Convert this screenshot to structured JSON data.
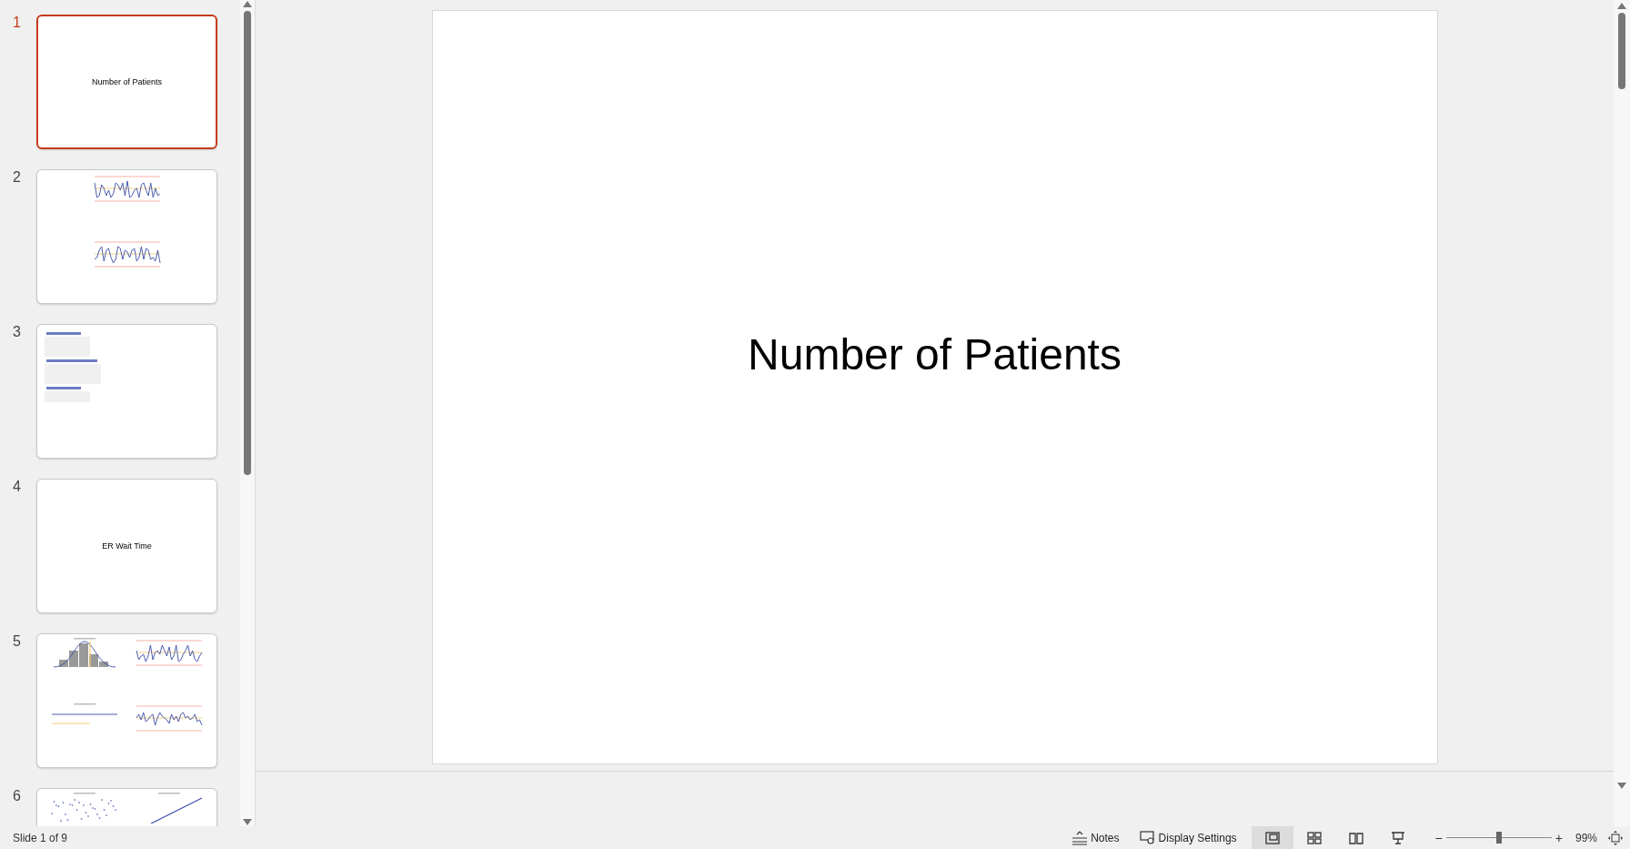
{
  "slides_panel": {
    "slides": [
      {
        "number": "1",
        "selected": true,
        "kind": "title",
        "title": "Number of Patients"
      },
      {
        "number": "2",
        "selected": false,
        "kind": "stack",
        "charts": [
          {
            "kind": "line"
          },
          {
            "kind": "line"
          }
        ]
      },
      {
        "number": "3",
        "selected": false,
        "kind": "stats"
      },
      {
        "number": "4",
        "selected": false,
        "kind": "title",
        "title": "ER Wait Time"
      },
      {
        "number": "5",
        "selected": false,
        "kind": "grid",
        "charts": [
          {
            "kind": "histogram"
          },
          {
            "kind": "line"
          },
          {
            "kind": "range"
          },
          {
            "kind": "line"
          }
        ]
      },
      {
        "number": "6",
        "selected": false,
        "kind": "grid",
        "charts": [
          {
            "kind": "scatter"
          },
          {
            "kind": "diagonal"
          }
        ]
      }
    ]
  },
  "slide": {
    "title": "Number of Patients"
  },
  "status_bar": {
    "slide_counter": "Slide 1 of 9",
    "notes": "Notes",
    "display_settings": "Display Settings",
    "views": [
      {
        "kind": "normal",
        "selected": true
      },
      {
        "kind": "sorter",
        "selected": false
      },
      {
        "kind": "reading",
        "selected": false
      },
      {
        "kind": "slideshow",
        "selected": false
      }
    ],
    "zoom": {
      "minus": "−",
      "plus": "+",
      "level": 0.5,
      "reading": "99%"
    }
  }
}
